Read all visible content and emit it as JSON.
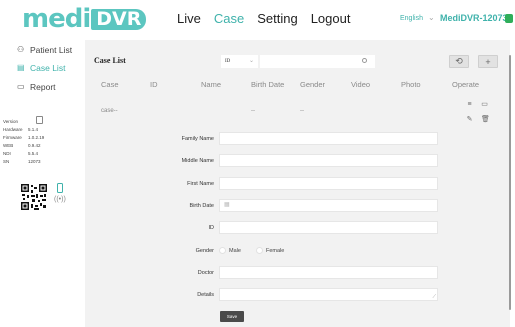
{
  "app": {
    "logo_main": "medi",
    "logo_box": "DVR",
    "device_name": "MediDVR-12073",
    "language": "English",
    "colors": {
      "accent": "#3fb2ab",
      "status": "#2fae5a"
    }
  },
  "nav": {
    "items": [
      "Live",
      "Case",
      "Setting",
      "Logout"
    ],
    "active": "Case"
  },
  "sidebar": {
    "items": [
      {
        "label": "Patient List",
        "icon": "patient-list-icon"
      },
      {
        "label": "Case List",
        "icon": "case-list-icon"
      },
      {
        "label": "Report",
        "icon": "report-icon"
      }
    ],
    "info": [
      {
        "k": "Version",
        "v": ""
      },
      {
        "k": "Hardware",
        "v": "5.1.4"
      },
      {
        "k": "Firmware",
        "v": "1.0.2.19"
      },
      {
        "k": "WEB",
        "v": "0.9.42"
      },
      {
        "k": "NDI",
        "v": "5.5.4"
      },
      {
        "k": "SN",
        "v": "12073"
      }
    ]
  },
  "case_list": {
    "title": "Case List",
    "search_type": "ID",
    "search_placeholder": "",
    "columns": [
      "Case",
      "ID",
      "Name",
      "Birth Date",
      "Gender",
      "Video",
      "Photo",
      "Operate"
    ],
    "row": {
      "case": "case--",
      "birth": "--",
      "gender": "--"
    }
  },
  "form": {
    "family_name_label": "Family Name",
    "middle_name_label": "Middle Name",
    "first_name_label": "First Name",
    "birth_date_label": "Birth Date",
    "id_label": "ID",
    "gender_label": "Gender",
    "gender_male": "Male",
    "gender_female": "Female",
    "doctor_label": "Doctor",
    "details_label": "Details",
    "save_label": "Save"
  }
}
